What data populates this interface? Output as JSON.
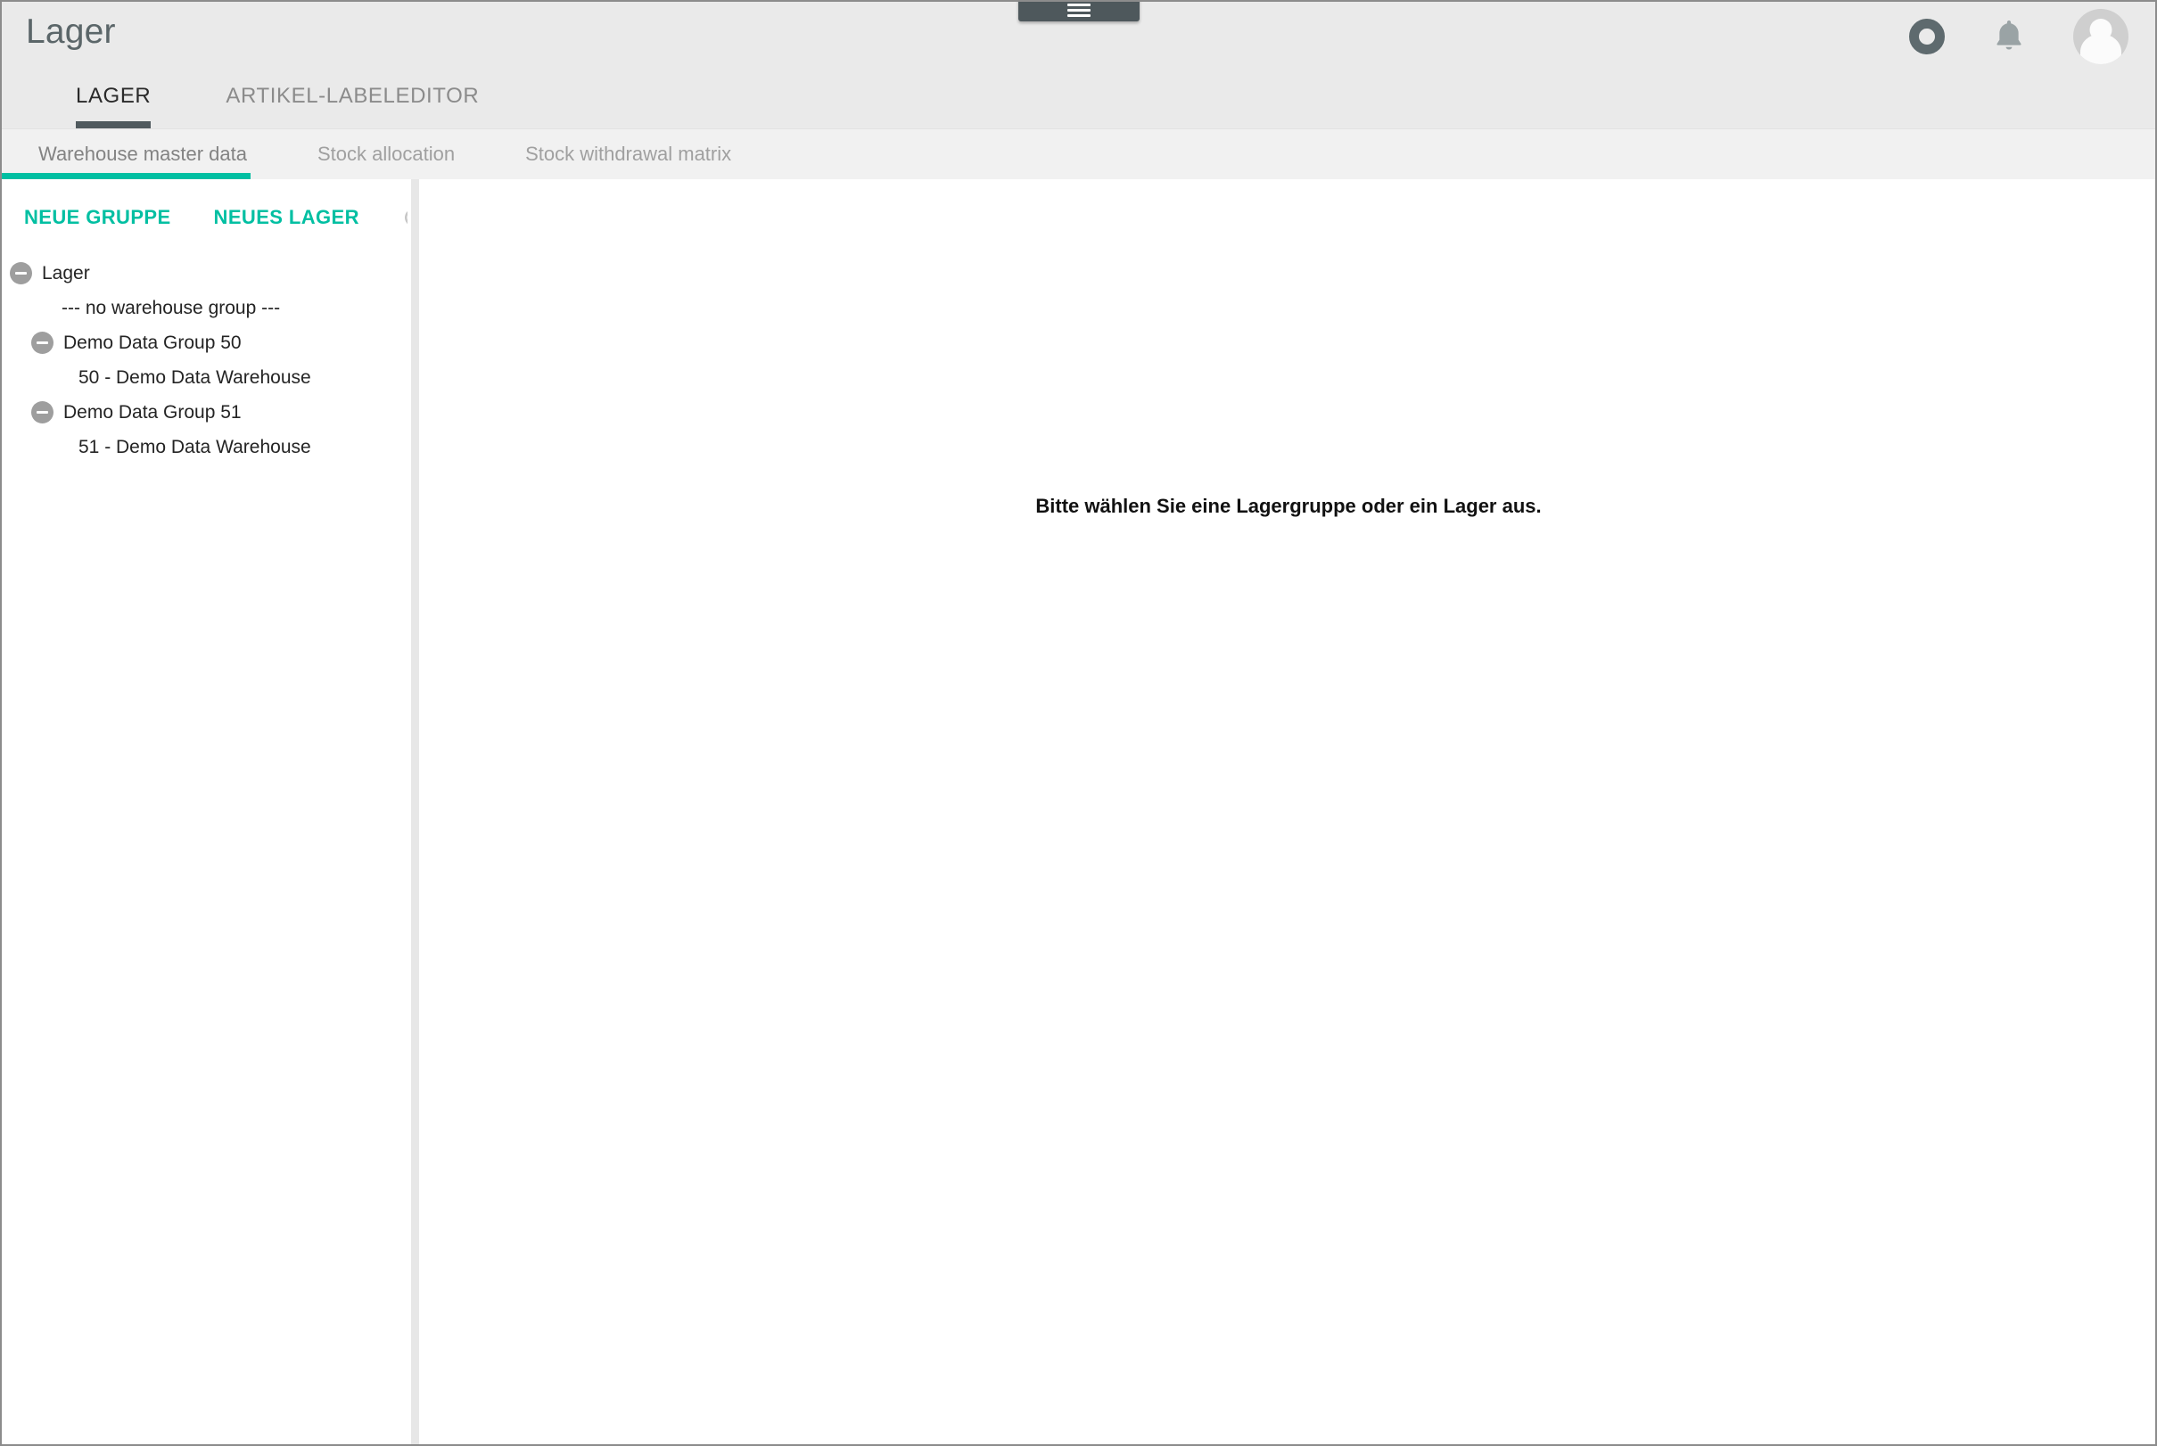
{
  "header": {
    "title": "Lager",
    "menu_handle_icon": "hamburger-menu-icon",
    "icons": [
      {
        "name": "status-ring-icon",
        "label": ""
      },
      {
        "name": "notifications-bell-icon",
        "label": ""
      },
      {
        "name": "user-avatar-icon",
        "label": ""
      }
    ],
    "main_tabs": [
      {
        "label": "LAGER",
        "active": true
      },
      {
        "label": "ARTIKEL-LABELEDITOR",
        "active": false
      }
    ]
  },
  "sub_tabs": [
    {
      "label": "Warehouse master data",
      "active": true
    },
    {
      "label": "Stock allocation",
      "active": false
    },
    {
      "label": "Stock withdrawal matrix",
      "active": false
    }
  ],
  "sidebar": {
    "actions": {
      "new_group_label": "NEUE GRUPPE",
      "new_warehouse_label": "NEUES LAGER",
      "refresh_icon": "refresh-icon"
    },
    "tree": [
      {
        "label": "Lager",
        "level": 0,
        "expandable": true,
        "expanded": true
      },
      {
        "label": "--- no warehouse group ---",
        "level": 1,
        "expandable": false,
        "expanded": false
      },
      {
        "label": "Demo Data Group 50",
        "level": 1,
        "expandable": true,
        "expanded": true
      },
      {
        "label": "50 - Demo Data Warehouse",
        "level": 2,
        "expandable": false,
        "expanded": false
      },
      {
        "label": "Demo Data Group 51",
        "level": 1,
        "expandable": true,
        "expanded": true
      },
      {
        "label": "51 - Demo Data Warehouse",
        "level": 2,
        "expandable": false,
        "expanded": false
      }
    ]
  },
  "content": {
    "empty_message": "Bitte wählen Sie eine Lagergruppe oder ein Lager aus."
  },
  "colors": {
    "accent_teal": "#00bfa2",
    "header_bg": "#eaeaea",
    "subtab_bg": "#f1f1f1",
    "active_tab_underline": "#505a5e",
    "title_text": "#5b6669",
    "tree_toggle": "#9e9e9e"
  }
}
